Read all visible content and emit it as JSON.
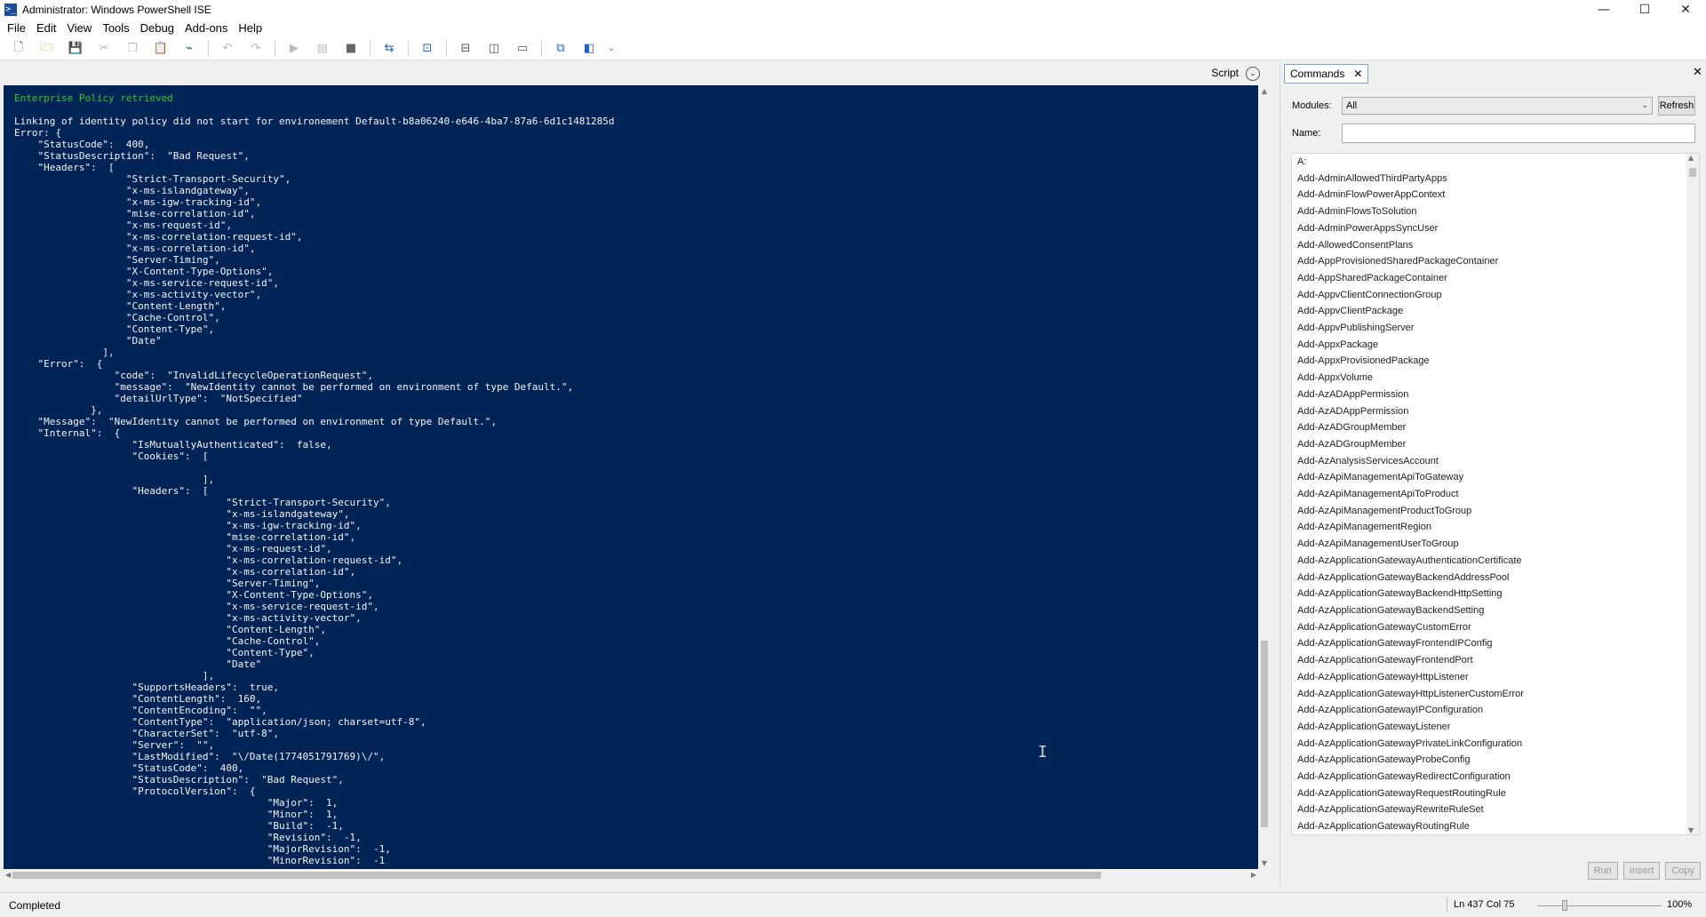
{
  "window": {
    "title": "Administrator: Windows PowerShell ISE",
    "icon": "powershell-icon",
    "controls": [
      "—",
      "☐",
      "✕"
    ]
  },
  "menu": [
    "File",
    "Edit",
    "View",
    "Tools",
    "Debug",
    "Add-ons",
    "Help"
  ],
  "script_pane": {
    "label": "Script"
  },
  "console": {
    "lines": [
      "Enterprise Policy retrieved",
      "",
      "Linking of identity policy did not start for environement Default-b8a06240-e646-4ba7-87a6-6d1c1481285d",
      "Error: {",
      "    \"StatusCode\":  400,",
      "    \"StatusDescription\":  \"Bad Request\",",
      "    \"Headers\":  [",
      "                   \"Strict-Transport-Security\",",
      "                   \"x-ms-islandgateway\",",
      "                   \"x-ms-igw-tracking-id\",",
      "                   \"mise-correlation-id\",",
      "                   \"x-ms-request-id\",",
      "                   \"x-ms-correlation-request-id\",",
      "                   \"x-ms-correlation-id\",",
      "                   \"Server-Timing\",",
      "                   \"X-Content-Type-Options\",",
      "                   \"x-ms-service-request-id\",",
      "                   \"x-ms-activity-vector\",",
      "                   \"Content-Length\",",
      "                   \"Cache-Control\",",
      "                   \"Content-Type\",",
      "                   \"Date\"",
      "               ],",
      "    \"Error\":  {",
      "                 \"code\":  \"InvalidLifecycleOperationRequest\",",
      "                 \"message\":  \"NewIdentity cannot be performed on environment of type Default.\",",
      "                 \"detailUrlType\":  \"NotSpecified\"",
      "             },",
      "    \"Message\":  \"NewIdentity cannot be performed on environment of type Default.\",",
      "    \"Internal\":  {",
      "                    \"IsMutuallyAuthenticated\":  false,",
      "                    \"Cookies\":  [",
      "",
      "                                ],",
      "                    \"Headers\":  [",
      "                                    \"Strict-Transport-Security\",",
      "                                    \"x-ms-islandgateway\",",
      "                                    \"x-ms-igw-tracking-id\",",
      "                                    \"mise-correlation-id\",",
      "                                    \"x-ms-request-id\",",
      "                                    \"x-ms-correlation-request-id\",",
      "                                    \"x-ms-correlation-id\",",
      "                                    \"Server-Timing\",",
      "                                    \"X-Content-Type-Options\",",
      "                                    \"x-ms-service-request-id\",",
      "                                    \"x-ms-activity-vector\",",
      "                                    \"Content-Length\",",
      "                                    \"Cache-Control\",",
      "                                    \"Content-Type\",",
      "                                    \"Date\"",
      "                                ],",
      "                    \"SupportsHeaders\":  true,",
      "                    \"ContentLength\":  160,",
      "                    \"ContentEncoding\":  \"\",",
      "                    \"ContentType\":  \"application/json; charset=utf-8\",",
      "                    \"CharacterSet\":  \"utf-8\",",
      "                    \"Server\":  \"\",",
      "                    \"LastModified\":  \"\\/Date(1774051791769)\\/\",",
      "                    \"StatusCode\":  400,",
      "                    \"StatusDescription\":  \"Bad Request\",",
      "                    \"ProtocolVersion\":  {",
      "                                           \"Major\":  1,",
      "                                           \"Minor\":  1,",
      "                                           \"Build\":  -1,",
      "                                           \"Revision\":  -1,",
      "                                           \"MajorRevision\":  -1,",
      "                                           \"MinorRevision\":  -1"
    ],
    "colors": {
      "background": "#012456",
      "text": "#f5f5f5",
      "success": "#32c832"
    }
  },
  "commands_pane": {
    "tab_label": "Commands",
    "modules_label": "Modules:",
    "modules_value": "All",
    "refresh_label": "Refresh",
    "name_label": "Name:",
    "name_value": "",
    "list": [
      "A:",
      "Add-AdminAllowedThirdPartyApps",
      "Add-AdminFlowPowerAppContext",
      "Add-AdminFlowsToSolution",
      "Add-AdminPowerAppsSyncUser",
      "Add-AllowedConsentPlans",
      "Add-AppProvisionedSharedPackageContainer",
      "Add-AppSharedPackageContainer",
      "Add-AppvClientConnectionGroup",
      "Add-AppvClientPackage",
      "Add-AppvPublishingServer",
      "Add-AppxPackage",
      "Add-AppxProvisionedPackage",
      "Add-AppxVolume",
      "Add-AzADAppPermission",
      "Add-AzADAppPermission",
      "Add-AzADGroupMember",
      "Add-AzADGroupMember",
      "Add-AzAnalysisServicesAccount",
      "Add-AzApiManagementApiToGateway",
      "Add-AzApiManagementApiToProduct",
      "Add-AzApiManagementProductToGroup",
      "Add-AzApiManagementRegion",
      "Add-AzApiManagementUserToGroup",
      "Add-AzApplicationGatewayAuthenticationCertificate",
      "Add-AzApplicationGatewayBackendAddressPool",
      "Add-AzApplicationGatewayBackendHttpSetting",
      "Add-AzApplicationGatewayBackendSetting",
      "Add-AzApplicationGatewayCustomError",
      "Add-AzApplicationGatewayFrontendIPConfig",
      "Add-AzApplicationGatewayFrontendPort",
      "Add-AzApplicationGatewayHttpListener",
      "Add-AzApplicationGatewayHttpListenerCustomError",
      "Add-AzApplicationGatewayIPConfiguration",
      "Add-AzApplicationGatewayListener",
      "Add-AzApplicationGatewayPrivateLinkConfiguration",
      "Add-AzApplicationGatewayProbeConfig",
      "Add-AzApplicationGatewayRedirectConfiguration",
      "Add-AzApplicationGatewayRequestRoutingRule",
      "Add-AzApplicationGatewayRewriteRuleSet",
      "Add-AzApplicationGatewayRoutingRule"
    ],
    "buttons": [
      "Run",
      "Insert",
      "Copy"
    ]
  },
  "status": {
    "text": "Completed",
    "position": "Ln 437  Col 75",
    "zoom": "100%"
  }
}
